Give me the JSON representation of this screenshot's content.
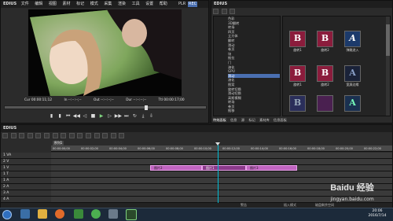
{
  "app": {
    "name": "EDIUS"
  },
  "player": {
    "title": "EDIUS",
    "menu": [
      "文件",
      "编辑",
      "视图",
      "素材",
      "标记",
      "模式",
      "采集",
      "渲染",
      "工具",
      "设置",
      "帮助"
    ],
    "mode_badge": "PLR",
    "mode_badge_active": "REC",
    "timecodes": {
      "cur": "Cur 00:00:11;12",
      "in": "In --:--:--;--",
      "out": "Out --:--:--;--",
      "dur": "Dur --:--:--;--",
      "ttl": "Ttl 00:00:17;00"
    }
  },
  "effects": {
    "title": "EDIUS",
    "tree_items": [
      "色彩",
      "3D翻转",
      "转场",
      "四页",
      "立方体",
      "翻转",
      "滑动",
      "卷页",
      "块",
      "推拉",
      "门",
      "溶化",
      "GPU",
      "滑动",
      "溶化",
      "图案",
      "旋转切换",
      "滑动切换",
      "高斯模糊",
      "转场",
      "卷页",
      "推移",
      "划像",
      "擦除",
      "柔化",
      "电视",
      "Alpha"
    ],
    "tiles_row1": [
      "B",
      "B",
      "A"
    ],
    "tiles_row2": [
      "B",
      "B",
      "A"
    ],
    "tiles_row3": [
      "B",
      "",
      "A"
    ],
    "tile_labels_row1": [
      "旋转1",
      "旋转2",
      "弹跳进入"
    ],
    "tile_labels_row2": [
      "旋转1",
      "旋转2",
      "宽屏边缘"
    ],
    "tabs": [
      "特效面板",
      "信息",
      "源",
      "标记",
      "素材库",
      "信息面板"
    ]
  },
  "timeline": {
    "title": "EDIUS",
    "sequence_tab": "序列1",
    "ruler_times": [
      "00:00:00;00",
      "00:00:02;00",
      "00:00:04;00",
      "00:00:06;00",
      "00:00:08;00",
      "00:00:10;00",
      "00:00:12;00",
      "00:00:14;00",
      "00:00:16;00",
      "00:00:18;00",
      "00:00:20;00",
      "00:00:22;00"
    ],
    "tracks": [
      "1 VA",
      "2 V",
      "1 V",
      "1 T",
      "1 A",
      "2 A",
      "3 A",
      "4 A"
    ],
    "clips": [
      "图片2",
      "图片1",
      "图片3"
    ],
    "status_left": "警告",
    "status_mid": "插入模式",
    "status_right": "磁盘剩余空间"
  },
  "taskbar": {
    "clock_time": "20:06",
    "clock_date": "2016/7/14",
    "watermark": "Baidu 经验",
    "watermark_url": "jingyan.baidu.com"
  },
  "colors": {
    "accent": "#4a6fb0",
    "clip": "#c064c0",
    "playhead": "#00bcd4"
  }
}
